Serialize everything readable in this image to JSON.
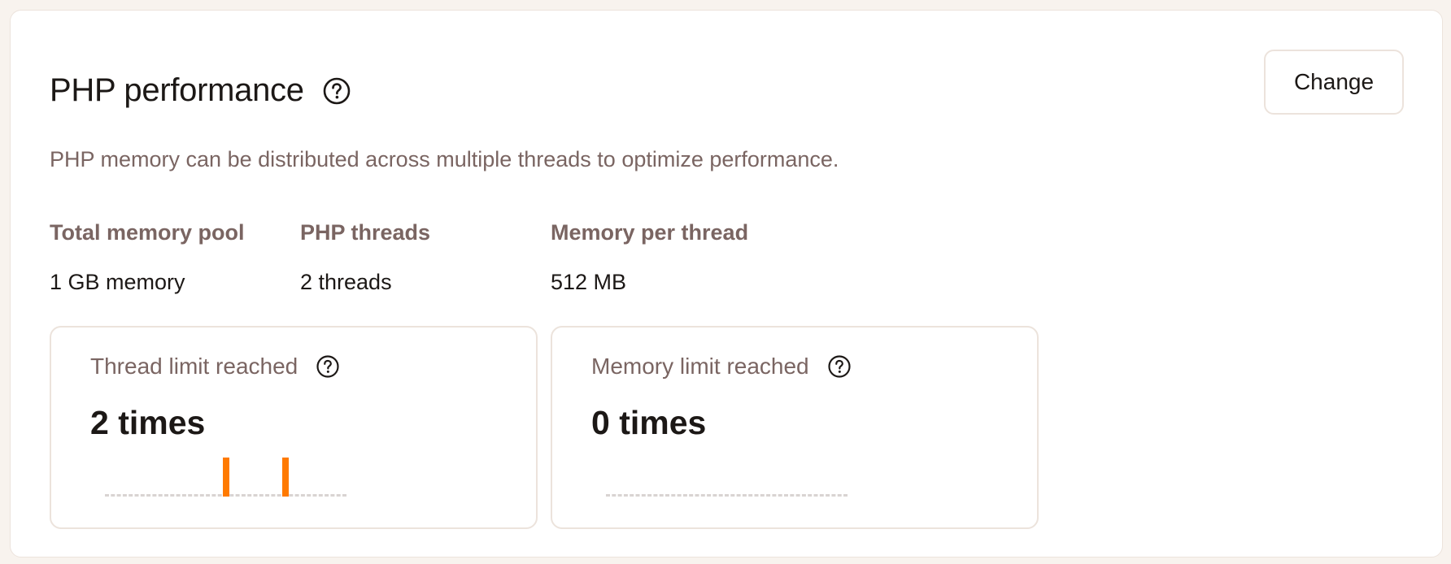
{
  "header": {
    "title": "PHP performance",
    "help_icon": "help-circle-icon",
    "change_label": "Change"
  },
  "description": "PHP memory can be distributed across multiple threads to optimize performance.",
  "stats": [
    {
      "label": "Total memory pool",
      "value": "1 GB memory"
    },
    {
      "label": "PHP threads",
      "value": "2 threads"
    },
    {
      "label": "Memory per thread",
      "value": "512 MB"
    }
  ],
  "cards": [
    {
      "label": "Thread limit reached",
      "value": "2 times",
      "help_icon": "help-circle-icon",
      "bars": [
        0,
        0,
        0,
        0,
        0,
        0,
        0,
        0,
        0,
        0,
        0,
        0,
        0,
        0,
        0,
        0,
        0,
        0,
        0,
        0,
        1,
        0,
        0,
        0,
        0,
        0,
        0,
        0,
        0,
        0,
        1,
        0,
        0,
        0,
        0,
        0,
        0,
        0,
        0,
        0,
        0
      ]
    },
    {
      "label": "Memory limit reached",
      "value": "0 times",
      "help_icon": "help-circle-icon",
      "bars": [
        0,
        0,
        0,
        0,
        0,
        0,
        0,
        0,
        0,
        0,
        0,
        0,
        0,
        0,
        0,
        0,
        0,
        0,
        0,
        0,
        0,
        0,
        0,
        0,
        0,
        0,
        0,
        0,
        0,
        0,
        0,
        0,
        0,
        0,
        0,
        0,
        0,
        0,
        0,
        0,
        0
      ]
    }
  ],
  "colors": {
    "bar_active": "#ff7a00",
    "bar_idle": "#d9d4d2",
    "muted_text": "#7a6562",
    "border": "#ece3dc"
  }
}
